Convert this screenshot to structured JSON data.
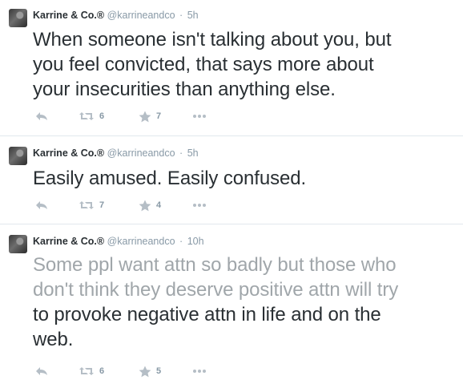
{
  "tweets": [
    {
      "author_name": "Karrine & Co.®",
      "handle": "@karrineandco",
      "separator": "·",
      "time": "5h",
      "text_lines": [
        "When someone isn't talking about you, but",
        "you feel convicted, that says more about",
        "your insecurities than anything else."
      ],
      "retweets": "6",
      "favorites": "7"
    },
    {
      "author_name": "Karrine & Co.®",
      "handle": "@karrineandco",
      "separator": "·",
      "time": "5h",
      "text_lines": [
        "Easily amused. Easily confused."
      ],
      "retweets": "7",
      "favorites": "4"
    },
    {
      "author_name": "Karrine & Co.®",
      "handle": "@karrineandco",
      "separator": "·",
      "time": "10h",
      "text_lines": [
        "Some ppl want attn so badly but those who",
        "don't think they deserve positive attn will try",
        "to provoke negative attn in life and on the",
        "web."
      ],
      "retweets": "6",
      "favorites": "5"
    }
  ],
  "icons": {
    "reply": "reply-icon",
    "retweet": "retweet-icon",
    "favorite": "star-icon",
    "more": "more-icon"
  },
  "colors": {
    "text": "#292f33",
    "meta": "#8899a6",
    "divider": "#e1e8ed",
    "faded_text": "#a0a6aa"
  }
}
